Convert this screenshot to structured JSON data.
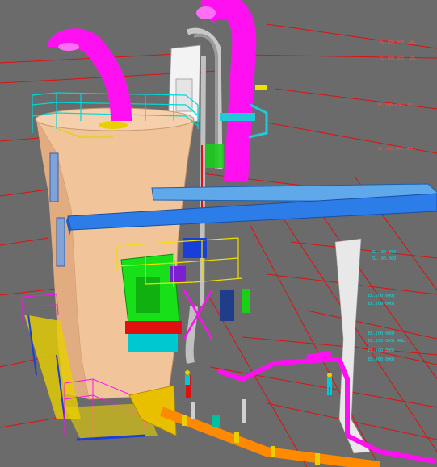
{
  "viewport": {
    "background": "#6b6b6b",
    "colors": {
      "vessel": "#f2c49a",
      "duct_magenta": "#ff10f0",
      "platform_green": "#18e018",
      "beam_blue": "#2d7de8",
      "pipe_orange": "#ff8a00",
      "railing_cyan": "#00d8d8",
      "leader_red": "#e01010",
      "pipe_grey": "#b9b9b9"
    },
    "elevation_labels": [
      "EL.(00.000) ABL.",
      "EL.(00.000) ABL.",
      "EL.(00.000) ABL.",
      "EL.(00.000) ABL.",
      "EL.(00.000)",
      "EL.(00.000)",
      "EL.(00.000)",
      "EL.(00.000)",
      "EL.(00.000)",
      "EL.(00.000) ABL.",
      "EL.(00.000)",
      "EL.(00.000)"
    ]
  }
}
